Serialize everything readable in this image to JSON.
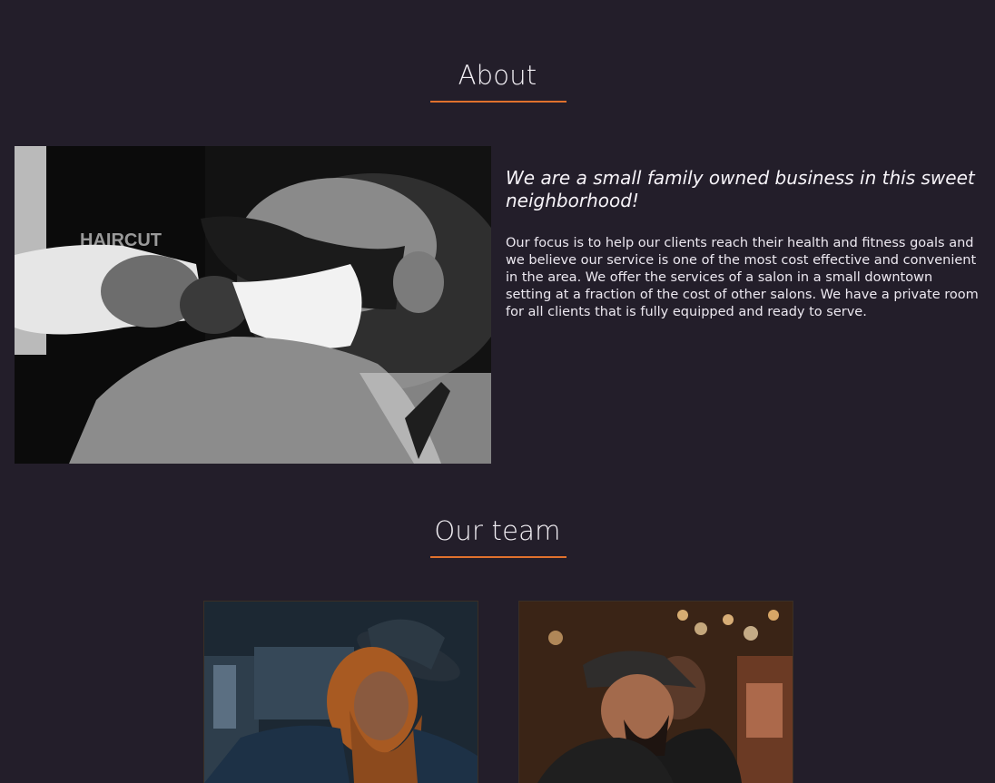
{
  "about": {
    "heading": "About",
    "tagline": "We are a small family owned business in this sweet neighborhood!",
    "body": "Our focus is to help our clients reach their health and fitness goals and we believe our service is one of the most cost effective and convenient in the area. We offer the services of a salon in a small downtown setting at a fraction of the cost of other salons. We have a private room for all clients that is fully equipped and ready to serve.",
    "image_alt": "Barber brushing shaving cream on a bearded client",
    "apron_text": "HAIRCUT"
  },
  "team": {
    "heading": "Our team",
    "members": [
      {
        "image_alt": "Barber with curly red hair and beard wearing a black hat"
      },
      {
        "image_alt": "Barber in a cap cutting a client's hair"
      }
    ]
  },
  "colors": {
    "background": "#231e2a",
    "accent": "#e0712d",
    "text": "#f1eef4"
  }
}
